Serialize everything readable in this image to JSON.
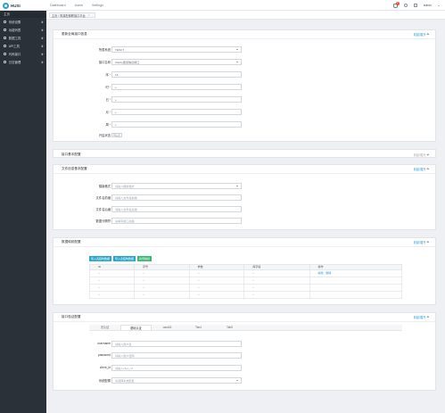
{
  "app": {
    "logo_text": "HUSI"
  },
  "topbar": {
    "nav": [
      "Dashboard",
      "Users",
      "Settings"
    ],
    "notification_count": "3",
    "user_name": "admin"
  },
  "sidebar": {
    "home": "主页",
    "items": [
      {
        "label": "系统设置",
        "icon": "gear-icon"
      },
      {
        "label": "功能列表",
        "icon": "list-icon"
      },
      {
        "label": "数据工具",
        "icon": "grid-icon"
      },
      {
        "label": "API工具",
        "icon": "code-icon"
      },
      {
        "label": "代码接口",
        "icon": "terminal-icon"
      },
      {
        "label": "日志管理",
        "icon": "log-icon"
      }
    ]
  },
  "breadcrumb": {
    "tab_label": "主页 / 简易配置联接口平台",
    "close": "×"
  },
  "panel_basic": {
    "title": "更新全局接口信息",
    "link": "收起/展开",
    "fields": [
      {
        "label": "所属系统",
        "value": "TESCT",
        "type": "select",
        "required": false
      },
      {
        "label": "接口名称",
        "value": "Clarity通道信息接口",
        "type": "select",
        "required": false
      },
      {
        "label": "序",
        "value": "15",
        "type": "text",
        "required": true
      },
      {
        "label": "时",
        "value": "+",
        "type": "text",
        "required": true
      },
      {
        "label": "日",
        "value": "+",
        "type": "text",
        "required": true
      },
      {
        "label": "月",
        "value": "+",
        "type": "text",
        "required": true
      },
      {
        "label": "周",
        "value": "+",
        "type": "text",
        "required": true
      }
    ],
    "toggle_label": "开启状态",
    "toggle_text": "关闭"
  },
  "panel_collapsed": {
    "title": "接口基本配置",
    "link": "收起/展开"
  },
  "panel_file": {
    "title": "文件信息基本配置",
    "link": "收起/展开",
    "fields": [
      {
        "label": "模版格式",
        "placeholder": "请输入模版格式",
        "type": "select"
      },
      {
        "label": "文件名前缀",
        "placeholder": "请输入文件名前缀",
        "type": "text"
      },
      {
        "label": "文件名后缀",
        "placeholder": "请输入文件名后缀",
        "type": "text"
      },
      {
        "label": "数据分隔符",
        "placeholder": "请填写接口后缀",
        "type": "text"
      }
    ]
  },
  "panel_mapping": {
    "title": "数据映射配置",
    "link": "收起/展开",
    "buttons": [
      "导入表结构数据",
      "导入表结构数据",
      "新增映射"
    ],
    "columns": [
      "ID",
      "序号",
      "参数",
      "库字段",
      "操作"
    ],
    "rows": [
      [
        "--",
        "--",
        "--",
        "--",
        ""
      ],
      [
        "--",
        "--",
        "--",
        "--",
        ""
      ],
      [
        "--",
        "--",
        "--",
        "--",
        ""
      ],
      [
        "--",
        "--",
        "--",
        "--",
        ""
      ]
    ],
    "row_actions": [
      "编辑",
      "删除"
    ]
  },
  "panel_auth": {
    "title": "接口验证配置",
    "link": "收起/展开",
    "tabs": [
      "无认证",
      "基础认证",
      "oauth2",
      "Tab4",
      "Tab5"
    ],
    "active_tab": 1,
    "fields": [
      {
        "label": "username",
        "placeholder": "请输入用户名",
        "type": "text"
      },
      {
        "label": "password",
        "placeholder": "请输入用户密码",
        "type": "text"
      },
      {
        "label": "client_id",
        "placeholder": "请输入clien_id",
        "type": "text"
      },
      {
        "label": "系统配置",
        "placeholder": "请选择系统配置",
        "type": "select"
      }
    ]
  },
  "colors": {
    "accent": "#2d9bd4",
    "sidebar_bg": "#2b3138",
    "btn_blue": "#27a7cf",
    "btn_green": "#36b971",
    "badge": "#e64a3b"
  }
}
